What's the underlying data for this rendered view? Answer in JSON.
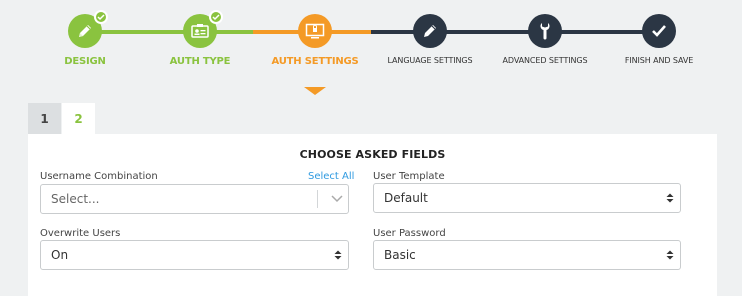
{
  "wizard": {
    "steps": [
      {
        "label": "DESIGN",
        "icon": "pencil-icon",
        "state": "done"
      },
      {
        "label": "AUTH TYPE",
        "icon": "id-card-icon",
        "state": "done"
      },
      {
        "label": "AUTH SETTINGS",
        "icon": "monitor-icon",
        "state": "active"
      },
      {
        "label": "LANGUAGE SETTINGS",
        "icon": "pencil-icon",
        "state": "todo"
      },
      {
        "label": "ADVANCED SETTINGS",
        "icon": "wrench-icon",
        "state": "todo"
      },
      {
        "label": "FINISH AND SAVE",
        "icon": "check-icon",
        "state": "todo"
      }
    ],
    "colors": {
      "done": "#8ac33f",
      "active": "#f49a26",
      "todo": "#2b3644"
    }
  },
  "tabs": [
    {
      "label": "1",
      "active": false
    },
    {
      "label": "2",
      "active": true
    }
  ],
  "panel": {
    "title": "CHOOSE ASKED FIELDS",
    "username_combination": {
      "label": "Username Combination",
      "select_all": "Select All",
      "value": "Select..."
    },
    "user_template": {
      "label": "User Template",
      "value": "Default"
    },
    "overwrite_users": {
      "label": "Overwrite Users",
      "value": "On"
    },
    "user_password": {
      "label": "User Password",
      "value": "Basic"
    }
  }
}
